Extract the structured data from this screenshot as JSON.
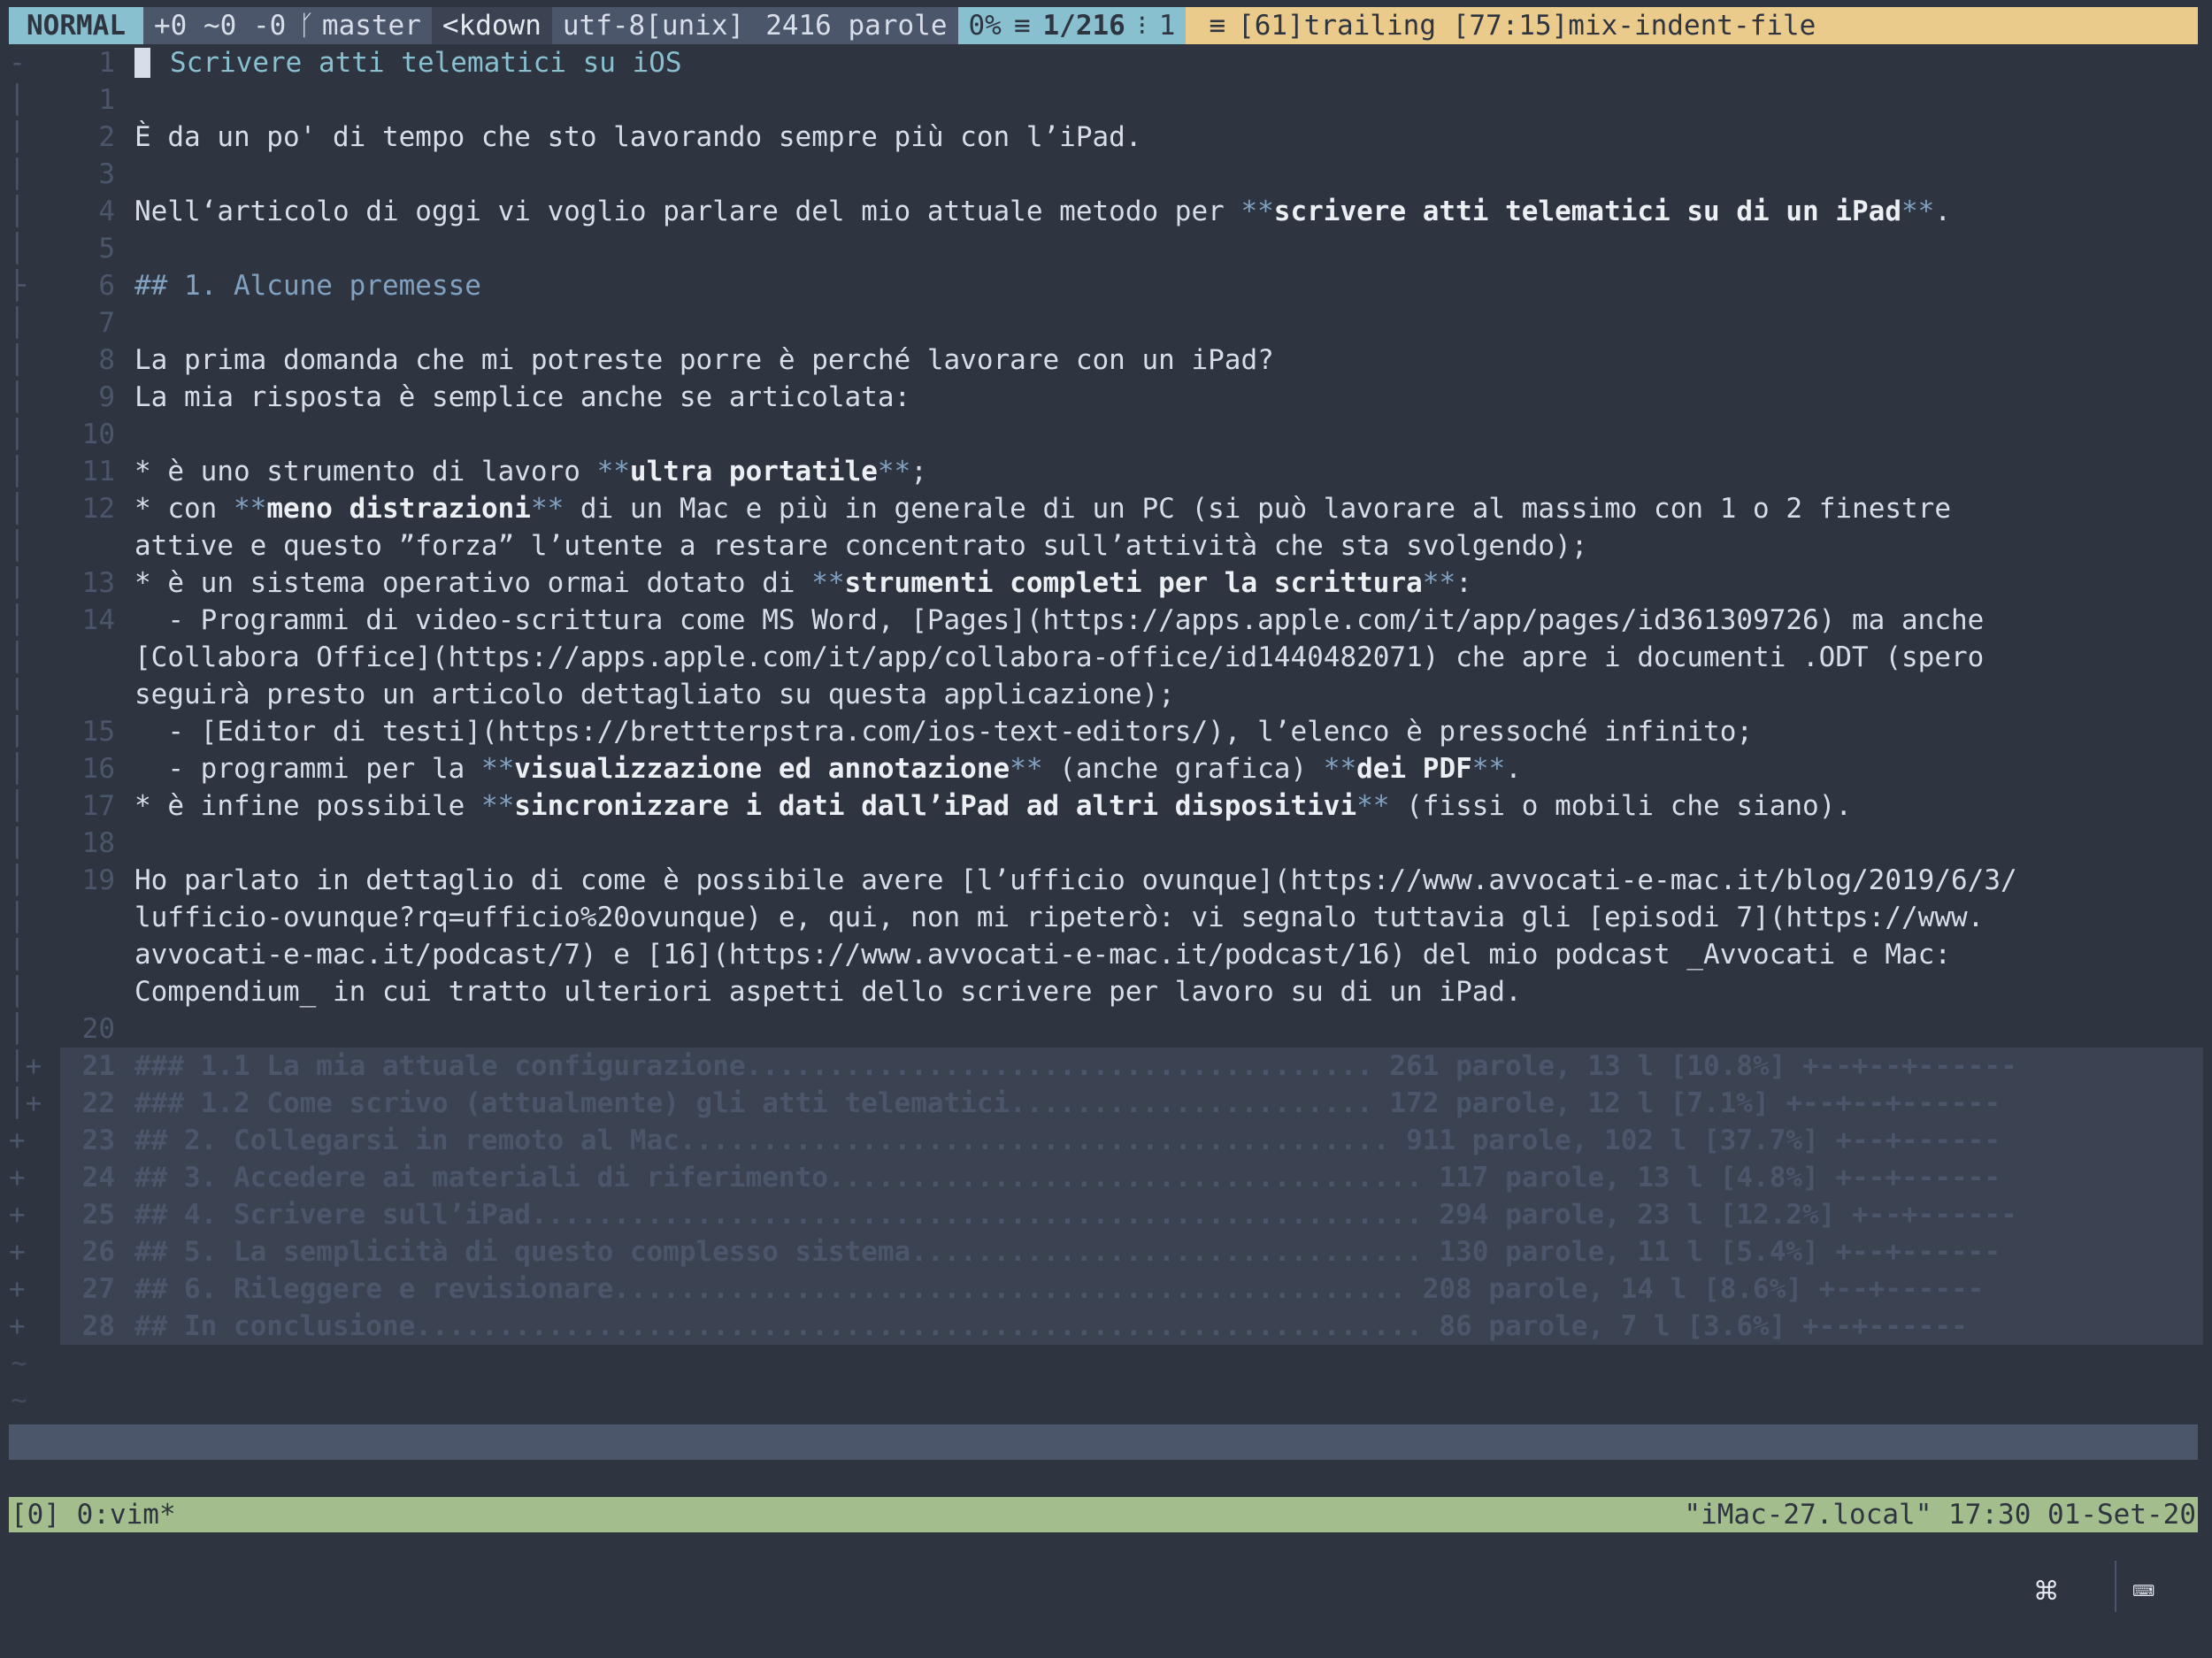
{
  "airline": {
    "mode": "NORMAL",
    "git_stats": "+0 ~0 -0",
    "branch": "master",
    "filetype": "<kdown",
    "encoding": "utf-8[unix]",
    "word_count": "2416 parole",
    "percent": "0%",
    "position": "1/216",
    "column": "1",
    "warnings": "[61]trailing [77:15]mix-indent-file"
  },
  "lines": [
    {
      "num": "1",
      "text": "Scrivere atti telematici su iOS"
    },
    {
      "num": "1",
      "text": ""
    },
    {
      "num": "2",
      "text": "È da un po' di tempo che sto lavorando sempre più con l’iPad."
    },
    {
      "num": "3",
      "text": ""
    },
    {
      "num": "4",
      "pre": "Nell‘articolo di oggi vi voglio parlare del mio attuale metodo per ",
      "bold": "scrivere atti telematici su di un iPad",
      "post": "."
    },
    {
      "num": "5",
      "text": ""
    },
    {
      "num": "6",
      "text": "## 1. Alcune premesse"
    },
    {
      "num": "7",
      "text": ""
    },
    {
      "num": "8",
      "text": "La prima domanda che mi potreste porre è perché lavorare con un iPad?"
    },
    {
      "num": "9",
      "text": "La mia risposta è semplice anche se articolata:"
    },
    {
      "num": "10",
      "text": ""
    },
    {
      "num": "11",
      "pre": "* è uno strumento di lavoro ",
      "bold": "ultra portatile",
      "post": ";"
    },
    {
      "num": "12",
      "pre": "* con ",
      "bold": "meno distrazioni",
      "post": " di un Mac e più in generale di un PC (si può lavorare al massimo con 1 o 2 finestre"
    },
    {
      "num": "",
      "text": "attive e questo ”forza” l’utente a restare concentrato sull’attività che sta svolgendo);"
    },
    {
      "num": "13",
      "pre": "* è un sistema operativo ormai dotato di ",
      "bold": "strumenti completi per la scrittura",
      "post": ":"
    },
    {
      "num": "14",
      "text": "  - Programmi di video-scrittura come MS Word, [Pages](https://apps.apple.com/it/app/pages/id361309726) ma anche"
    },
    {
      "num": "",
      "text": "[Collabora Office](https://apps.apple.com/it/app/collabora-office/id1440482071) che apre i documenti .ODT (spero"
    },
    {
      "num": "",
      "text": "seguirà presto un articolo dettagliato su questa applicazione);"
    },
    {
      "num": "15",
      "text": "  - [Editor di testi](https://brettterpstra.com/ios-text-editors/), l’elenco è pressoché infinito;"
    },
    {
      "num": "16",
      "pre": "  - programmi per la ",
      "bold": "visualizzazione ed annotazione",
      "mid": " (anche grafica) ",
      "bold2": "dei PDF",
      "post": "."
    },
    {
      "num": "17",
      "pre": "* è infine possibile ",
      "bold": "sincronizzare i dati dall’iPad ad altri dispositivi",
      "post": " (fissi o mobili che siano)."
    },
    {
      "num": "18",
      "text": ""
    },
    {
      "num": "19",
      "text": "Ho parlato in dettaglio di come è possibile avere [l’ufficio ovunque](https://www.avvocati-e-mac.it/blog/2019/6/3/"
    },
    {
      "num": "",
      "text": "lufficio-ovunque?rq=ufficio%20ovunque) e, qui, non mi ripeterò: vi segnalo tuttavia gli [episodi 7](https://www."
    },
    {
      "num": "",
      "text": "avvocati-e-mac.it/podcast/7) e [16](https://www.avvocati-e-mac.it/podcast/16) del mio podcast _Avvocati e Mac:"
    },
    {
      "num": "",
      "text": "Compendium_ in cui tratto ulteriori aspetti dello scrivere per lavoro su di un iPad."
    },
    {
      "num": "20",
      "text": ""
    }
  ],
  "folds": [
    {
      "num": "21",
      "text": "### 1.1 La mia attuale configurazione...................................... 261 parole, 13 l [10.8%] +--+--+------"
    },
    {
      "num": "22",
      "text": "### 1.2 Come scrivo (attualmente) gli atti telematici...................... 172 parole, 12 l [7.1%] +--+--+------"
    },
    {
      "num": "23",
      "text": "## 2. Collegarsi in remoto al Mac........................................... 911 parole, 102 l [37.7%] +--+------"
    },
    {
      "num": "24",
      "text": "## 3. Accedere ai materiali di riferimento.................................... 117 parole, 13 l [4.8%] +--+------"
    },
    {
      "num": "25",
      "text": "## 4. Scrivere sull’iPad...................................................... 294 parole, 23 l [12.2%] +--+------"
    },
    {
      "num": "26",
      "text": "## 5. La semplicità di questo complesso sistema............................... 130 parole, 11 l [5.4%] +--+------"
    },
    {
      "num": "27",
      "text": "## 6. Rileggere e revisionare................................................ 208 parole, 14 l [8.6%] +--+------"
    },
    {
      "num": "28",
      "text": "## In conclusione............................................................. 86 parole, 7 l [3.6%] +--+------"
    }
  ],
  "tmux": {
    "left": "[0] 0:vim*",
    "right": "\"iMac-27.local\" 17:30 01-Set-20"
  },
  "toolbar": {
    "cmd_icon": "⌘",
    "keyboard_icon": "⌨"
  }
}
